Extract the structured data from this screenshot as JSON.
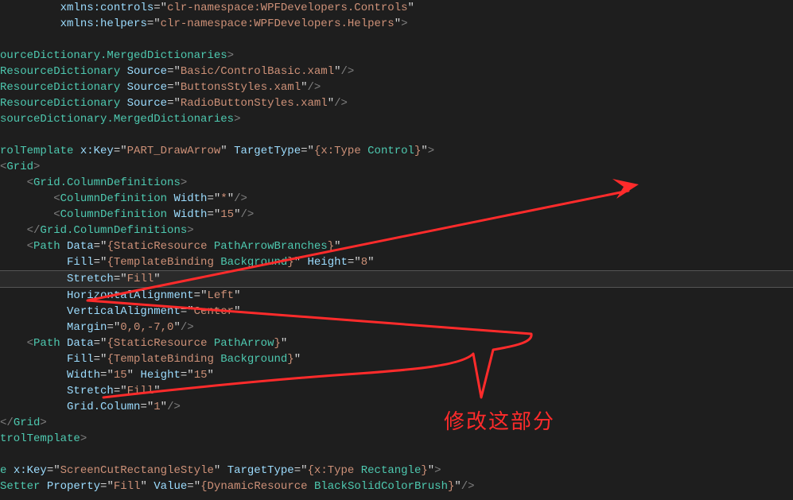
{
  "colors": {
    "bg": "#1e1e1e",
    "tag": "#4ec9b0",
    "attr": "#9cdcfe",
    "string": "#ce9178",
    "annotation": "#ff2b2b"
  },
  "annotation_text": "修改这部分",
  "lines": [
    {
      "indent": "         ",
      "tokens": [
        [
          "attr",
          "xmlns:controls"
        ],
        [
          "op",
          "="
        ],
        [
          "quote",
          "\""
        ],
        [
          "string",
          "clr-namespace:WPFDevelopers.Controls"
        ],
        [
          "quote",
          "\""
        ]
      ]
    },
    {
      "indent": "         ",
      "tokens": [
        [
          "attr",
          "xmlns:helpers"
        ],
        [
          "op",
          "="
        ],
        [
          "quote",
          "\""
        ],
        [
          "string",
          "clr-namespace:WPFDevelopers.Helpers"
        ],
        [
          "quote",
          "\""
        ],
        [
          "punc",
          ">"
        ]
      ]
    },
    {
      "indent": "",
      "tokens": []
    },
    {
      "indent": "",
      "tokens": [
        [
          "tag",
          "ourceDictionary.MergedDictionaries"
        ],
        [
          "punc",
          ">"
        ]
      ]
    },
    {
      "indent": "",
      "tokens": [
        [
          "tag",
          "ResourceDictionary"
        ],
        [
          "op",
          " "
        ],
        [
          "attr",
          "Source"
        ],
        [
          "op",
          "="
        ],
        [
          "quote",
          "\""
        ],
        [
          "string",
          "Basic/ControlBasic.xaml"
        ],
        [
          "quote",
          "\""
        ],
        [
          "punc",
          "/>"
        ]
      ]
    },
    {
      "indent": "",
      "tokens": [
        [
          "tag",
          "ResourceDictionary"
        ],
        [
          "op",
          " "
        ],
        [
          "attr",
          "Source"
        ],
        [
          "op",
          "="
        ],
        [
          "quote",
          "\""
        ],
        [
          "string",
          "ButtonsStyles.xaml"
        ],
        [
          "quote",
          "\""
        ],
        [
          "punc",
          "/>"
        ]
      ]
    },
    {
      "indent": "",
      "tokens": [
        [
          "tag",
          "ResourceDictionary"
        ],
        [
          "op",
          " "
        ],
        [
          "attr",
          "Source"
        ],
        [
          "op",
          "="
        ],
        [
          "quote",
          "\""
        ],
        [
          "string",
          "RadioButtonStyles.xaml"
        ],
        [
          "quote",
          "\""
        ],
        [
          "punc",
          "/>"
        ]
      ]
    },
    {
      "indent": "",
      "tokens": [
        [
          "tag",
          "sourceDictionary.MergedDictionaries"
        ],
        [
          "punc",
          ">"
        ]
      ]
    },
    {
      "indent": "",
      "tokens": []
    },
    {
      "indent": "",
      "tokens": [
        [
          "tag",
          "rolTemplate"
        ],
        [
          "op",
          " "
        ],
        [
          "attr",
          "x:Key"
        ],
        [
          "op",
          "="
        ],
        [
          "quote",
          "\""
        ],
        [
          "string",
          "PART_DrawArrow"
        ],
        [
          "quote",
          "\""
        ],
        [
          "op",
          " "
        ],
        [
          "attr",
          "TargetType"
        ],
        [
          "op",
          "="
        ],
        [
          "quote",
          "\""
        ],
        [
          "string",
          "{x:Type "
        ],
        [
          "tag",
          "Control"
        ],
        [
          "string",
          "}"
        ],
        [
          "quote",
          "\""
        ],
        [
          "punc",
          ">"
        ]
      ]
    },
    {
      "indent": "",
      "tokens": [
        [
          "punc",
          "<"
        ],
        [
          "tag",
          "Grid"
        ],
        [
          "punc",
          ">"
        ]
      ]
    },
    {
      "indent": "    ",
      "tokens": [
        [
          "punc",
          "<"
        ],
        [
          "tag",
          "Grid.ColumnDefinitions"
        ],
        [
          "punc",
          ">"
        ]
      ]
    },
    {
      "indent": "        ",
      "tokens": [
        [
          "punc",
          "<"
        ],
        [
          "tag",
          "ColumnDefinition"
        ],
        [
          "op",
          " "
        ],
        [
          "attr",
          "Width"
        ],
        [
          "op",
          "="
        ],
        [
          "quote",
          "\""
        ],
        [
          "string",
          "*"
        ],
        [
          "quote",
          "\""
        ],
        [
          "punc",
          "/>"
        ]
      ]
    },
    {
      "indent": "        ",
      "tokens": [
        [
          "punc",
          "<"
        ],
        [
          "tag",
          "ColumnDefinition"
        ],
        [
          "op",
          " "
        ],
        [
          "attr",
          "Width"
        ],
        [
          "op",
          "="
        ],
        [
          "quote",
          "\""
        ],
        [
          "string",
          "15"
        ],
        [
          "quote",
          "\""
        ],
        [
          "punc",
          "/>"
        ]
      ]
    },
    {
      "indent": "    ",
      "tokens": [
        [
          "punc",
          "</"
        ],
        [
          "tag",
          "Grid.ColumnDefinitions"
        ],
        [
          "punc",
          ">"
        ]
      ]
    },
    {
      "indent": "    ",
      "tokens": [
        [
          "punc",
          "<"
        ],
        [
          "tag",
          "Path"
        ],
        [
          "op",
          " "
        ],
        [
          "attr",
          "Data"
        ],
        [
          "op",
          "="
        ],
        [
          "quote",
          "\""
        ],
        [
          "string",
          "{StaticResource "
        ],
        [
          "tag",
          "PathArrowBranches"
        ],
        [
          "string",
          "}"
        ],
        [
          "quote",
          "\""
        ]
      ]
    },
    {
      "indent": "          ",
      "tokens": [
        [
          "attr",
          "Fill"
        ],
        [
          "op",
          "="
        ],
        [
          "quote",
          "\""
        ],
        [
          "string",
          "{TemplateBinding "
        ],
        [
          "tag",
          "Background"
        ],
        [
          "string",
          "}"
        ],
        [
          "quote",
          "\""
        ],
        [
          "op",
          " "
        ],
        [
          "attr",
          "Height"
        ],
        [
          "op",
          "="
        ],
        [
          "quote",
          "\""
        ],
        [
          "string",
          "8"
        ],
        [
          "quote",
          "\""
        ]
      ]
    },
    {
      "indent": "          ",
      "hl": true,
      "tokens": [
        [
          "attr",
          "Stretch"
        ],
        [
          "op",
          "="
        ],
        [
          "quote",
          "\""
        ],
        [
          "string",
          "Fill"
        ],
        [
          "quote",
          "\""
        ],
        [
          "op",
          " "
        ]
      ]
    },
    {
      "indent": "          ",
      "tokens": [
        [
          "attr",
          "HorizontalAlignment"
        ],
        [
          "op",
          "="
        ],
        [
          "quote",
          "\""
        ],
        [
          "string",
          "Left"
        ],
        [
          "quote",
          "\""
        ]
      ]
    },
    {
      "indent": "          ",
      "tokens": [
        [
          "attr",
          "VerticalAlignment"
        ],
        [
          "op",
          "="
        ],
        [
          "quote",
          "\""
        ],
        [
          "string",
          "Center"
        ],
        [
          "quote",
          "\""
        ]
      ]
    },
    {
      "indent": "          ",
      "tokens": [
        [
          "attr",
          "Margin"
        ],
        [
          "op",
          "="
        ],
        [
          "quote",
          "\""
        ],
        [
          "string",
          "0,0,-7,0"
        ],
        [
          "quote",
          "\""
        ],
        [
          "punc",
          "/>"
        ]
      ]
    },
    {
      "indent": "    ",
      "tokens": [
        [
          "punc",
          "<"
        ],
        [
          "tag",
          "Path"
        ],
        [
          "op",
          " "
        ],
        [
          "attr",
          "Data"
        ],
        [
          "op",
          "="
        ],
        [
          "quote",
          "\""
        ],
        [
          "string",
          "{StaticResource "
        ],
        [
          "tag",
          "PathArrow"
        ],
        [
          "string",
          "}"
        ],
        [
          "quote",
          "\""
        ]
      ]
    },
    {
      "indent": "          ",
      "tokens": [
        [
          "attr",
          "Fill"
        ],
        [
          "op",
          "="
        ],
        [
          "quote",
          "\""
        ],
        [
          "string",
          "{TemplateBinding "
        ],
        [
          "tag",
          "Background"
        ],
        [
          "string",
          "}"
        ],
        [
          "quote",
          "\""
        ]
      ]
    },
    {
      "indent": "          ",
      "tokens": [
        [
          "attr",
          "Width"
        ],
        [
          "op",
          "="
        ],
        [
          "quote",
          "\""
        ],
        [
          "string",
          "15"
        ],
        [
          "quote",
          "\""
        ],
        [
          "op",
          " "
        ],
        [
          "attr",
          "Height"
        ],
        [
          "op",
          "="
        ],
        [
          "quote",
          "\""
        ],
        [
          "string",
          "15"
        ],
        [
          "quote",
          "\""
        ]
      ]
    },
    {
      "indent": "          ",
      "tokens": [
        [
          "attr",
          "Stretch"
        ],
        [
          "op",
          "="
        ],
        [
          "quote",
          "\""
        ],
        [
          "string",
          "Fill"
        ],
        [
          "quote",
          "\""
        ]
      ]
    },
    {
      "indent": "          ",
      "tokens": [
        [
          "attr",
          "Grid.Column"
        ],
        [
          "op",
          "="
        ],
        [
          "quote",
          "\""
        ],
        [
          "string",
          "1"
        ],
        [
          "quote",
          "\""
        ],
        [
          "punc",
          "/>"
        ]
      ]
    },
    {
      "indent": "",
      "tokens": [
        [
          "punc",
          "</"
        ],
        [
          "tag",
          "Grid"
        ],
        [
          "punc",
          ">"
        ]
      ]
    },
    {
      "indent": "",
      "tokens": [
        [
          "tag",
          "trolTemplate"
        ],
        [
          "punc",
          ">"
        ]
      ]
    },
    {
      "indent": "",
      "tokens": []
    },
    {
      "indent": "",
      "tokens": [
        [
          "tag",
          "e"
        ],
        [
          "op",
          " "
        ],
        [
          "attr",
          "x:Key"
        ],
        [
          "op",
          "="
        ],
        [
          "quote",
          "\""
        ],
        [
          "string",
          "ScreenCutRectangleStyle"
        ],
        [
          "quote",
          "\""
        ],
        [
          "op",
          " "
        ],
        [
          "attr",
          "TargetType"
        ],
        [
          "op",
          "="
        ],
        [
          "quote",
          "\""
        ],
        [
          "string",
          "{x:Type "
        ],
        [
          "tag",
          "Rectangle"
        ],
        [
          "string",
          "}"
        ],
        [
          "quote",
          "\""
        ],
        [
          "punc",
          ">"
        ]
      ]
    },
    {
      "indent": "",
      "tokens": [
        [
          "tag",
          "Setter"
        ],
        [
          "op",
          " "
        ],
        [
          "attr",
          "Property"
        ],
        [
          "op",
          "="
        ],
        [
          "quote",
          "\""
        ],
        [
          "string",
          "Fill"
        ],
        [
          "quote",
          "\""
        ],
        [
          "op",
          " "
        ],
        [
          "attr",
          "Value"
        ],
        [
          "op",
          "="
        ],
        [
          "quote",
          "\""
        ],
        [
          "string",
          "{DynamicResource "
        ],
        [
          "tag",
          "BlackSolidColorBrush"
        ],
        [
          "string",
          "}"
        ],
        [
          "quote",
          "\""
        ],
        [
          "punc",
          "/>"
        ]
      ]
    }
  ]
}
